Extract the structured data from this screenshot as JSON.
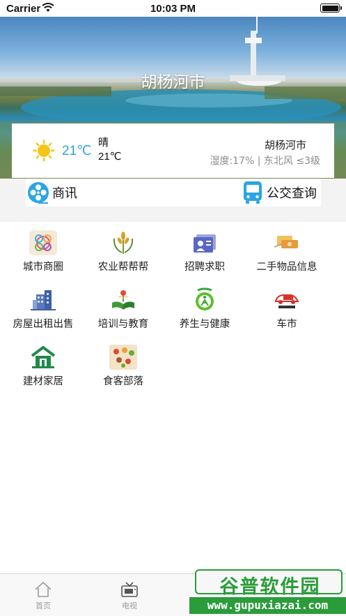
{
  "status_bar": {
    "carrier": "Carrier",
    "time": "10:03 PM"
  },
  "hero": {
    "city_title": "胡杨河市"
  },
  "weather": {
    "icon": "sun-icon",
    "temperature": "21℃",
    "condition": "晴",
    "temperature_small": "21℃",
    "city": "胡杨河市",
    "detail": "湿度:17% | 东北风 ≤3级",
    "colors": {
      "temperature": "#2ea6d9",
      "sun": "#f5c518"
    }
  },
  "quick_links": [
    {
      "label": "商讯",
      "icon": "film-reel-icon"
    },
    {
      "label": "公交查询",
      "icon": "bus-icon"
    }
  ],
  "categories": [
    {
      "label": "城市商圈",
      "icon": "city-circle-icon"
    },
    {
      "label": "农业帮帮帮",
      "icon": "wheat-icon"
    },
    {
      "label": "招聘求职",
      "icon": "id-card-icon"
    },
    {
      "label": "二手物品信息",
      "icon": "handshake-icon"
    },
    {
      "label": "房屋出租出售",
      "icon": "building-icon"
    },
    {
      "label": "培训与教育",
      "icon": "book-icon"
    },
    {
      "label": "养生与健康",
      "icon": "health-icon"
    },
    {
      "label": "车市",
      "icon": "car-icon"
    },
    {
      "label": "建材家居",
      "icon": "house-icon"
    },
    {
      "label": "食客部落",
      "icon": "food-icon"
    }
  ],
  "tabbar": [
    {
      "label": "首页",
      "icon": "home-icon"
    },
    {
      "label": "电视",
      "icon": "tv-icon"
    }
  ],
  "watermark": {
    "title": "谷普软件园",
    "url": "www.gupuxiazai.com",
    "color": "#2a9c3a"
  }
}
